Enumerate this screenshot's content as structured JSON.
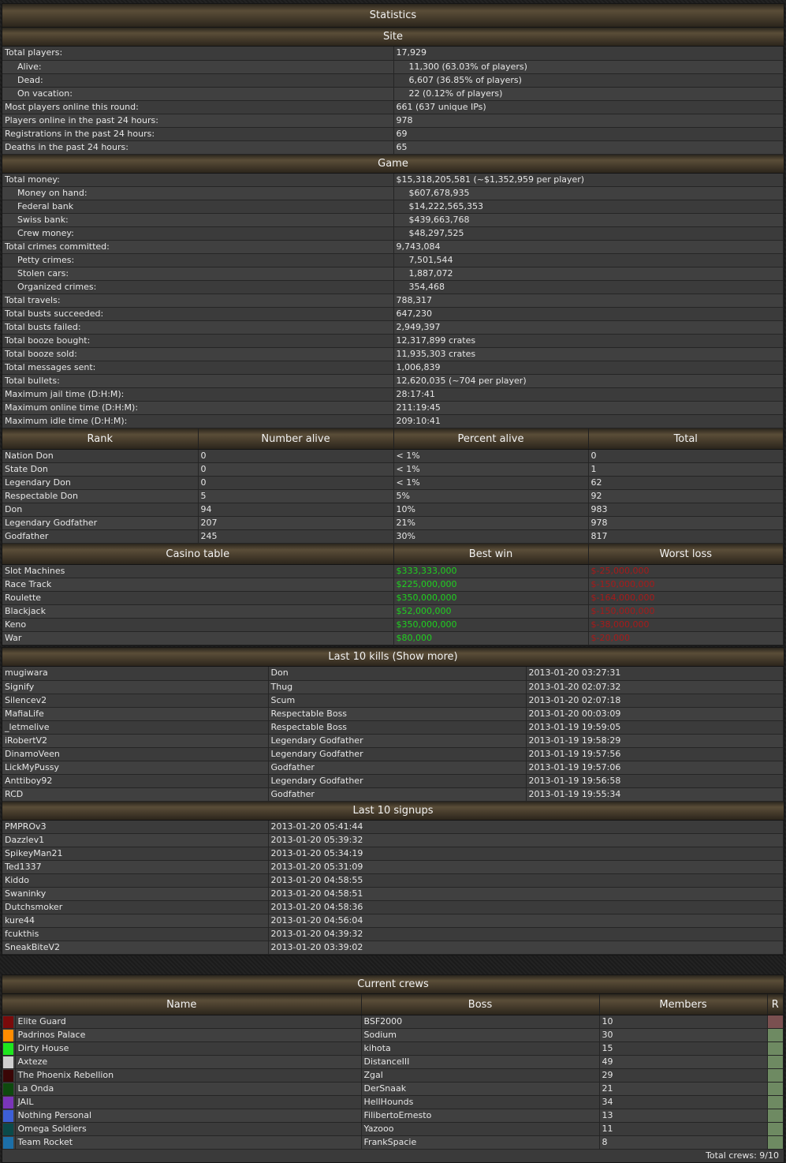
{
  "statistics": {
    "title": "Statistics",
    "site_header": "Site",
    "site_rows": [
      {
        "label": "Total players:",
        "value": "17,929",
        "indent": false
      },
      {
        "label": "Alive:",
        "value": "11,300 (63.03% of players)",
        "indent": true
      },
      {
        "label": "Dead:",
        "value": "6,607 (36.85% of players)",
        "indent": true
      },
      {
        "label": "On vacation:",
        "value": "22 (0.12% of players)",
        "indent": true
      },
      {
        "label": "Most players online this round:",
        "value": "661 (637 unique IPs)",
        "indent": false
      },
      {
        "label": "Players online in the past 24 hours:",
        "value": "978",
        "indent": false
      },
      {
        "label": "Registrations in the past 24 hours:",
        "value": "69",
        "indent": false
      },
      {
        "label": "Deaths in the past 24 hours:",
        "value": "65",
        "indent": false
      }
    ],
    "game_header": "Game",
    "game_rows": [
      {
        "label": "Total money:",
        "value": "$15,318,205,581 (~$1,352,959 per player)",
        "indent": false
      },
      {
        "label": "Money on hand:",
        "value": "$607,678,935",
        "indent": true
      },
      {
        "label": "Federal bank",
        "value": "$14,222,565,353",
        "indent": true
      },
      {
        "label": "Swiss bank:",
        "value": "$439,663,768",
        "indent": true
      },
      {
        "label": "Crew money:",
        "value": "$48,297,525",
        "indent": true
      },
      {
        "label": "Total crimes committed:",
        "value": "9,743,084",
        "indent": false
      },
      {
        "label": "Petty crimes:",
        "value": "7,501,544",
        "indent": true
      },
      {
        "label": "Stolen cars:",
        "value": "1,887,072",
        "indent": true
      },
      {
        "label": "Organized crimes:",
        "value": "354,468",
        "indent": true
      },
      {
        "label": "Total travels:",
        "value": "788,317",
        "indent": false
      },
      {
        "label": "Total busts succeeded:",
        "value": "647,230",
        "indent": false
      },
      {
        "label": "Total busts failed:",
        "value": "2,949,397",
        "indent": false
      },
      {
        "label": "Total booze bought:",
        "value": "12,317,899 crates",
        "indent": false
      },
      {
        "label": "Total booze sold:",
        "value": "11,935,303 crates",
        "indent": false
      },
      {
        "label": "Total messages sent:",
        "value": "1,006,839",
        "indent": false
      },
      {
        "label": "Total bullets:",
        "value": "12,620,035 (~704 per player)",
        "indent": false
      },
      {
        "label": "Maximum jail time (D:H:M):",
        "value": "28:17:41",
        "indent": false
      },
      {
        "label": "Maximum online time (D:H:M):",
        "value": "211:19:45",
        "indent": false
      },
      {
        "label": "Maximum idle time (D:H:M):",
        "value": "209:10:41",
        "indent": false
      }
    ],
    "rank_headers": [
      "Rank",
      "Number alive",
      "Percent alive",
      "Total"
    ],
    "rank_rows": [
      [
        "Nation Don",
        "0",
        "< 1%",
        "0"
      ],
      [
        "State Don",
        "0",
        "< 1%",
        "1"
      ],
      [
        "Legendary Don",
        "0",
        "< 1%",
        "62"
      ],
      [
        "Respectable Don",
        "5",
        "5%",
        "92"
      ],
      [
        "Don",
        "94",
        "10%",
        "983"
      ],
      [
        "Legendary Godfather",
        "207",
        "21%",
        "978"
      ],
      [
        "Godfather",
        "245",
        "30%",
        "817"
      ]
    ],
    "casino_headers": [
      "Casino table",
      "Best win",
      "Worst loss"
    ],
    "casino_rows": [
      [
        "Slot Machines",
        "$333,333,000",
        "$-25,000,000"
      ],
      [
        "Race Track",
        "$225,000,000",
        "$-150,000,000"
      ],
      [
        "Roulette",
        "$350,000,000",
        "$-164,000,000"
      ],
      [
        "Blackjack",
        "$52,000,000",
        "$-150,000,000"
      ],
      [
        "Keno",
        "$350,000,000",
        "$-38,000,000"
      ],
      [
        "War",
        "$80,000",
        "$-20,000"
      ]
    ]
  },
  "kills": {
    "title": "Last 10 kills (Show more)",
    "rows": [
      [
        "mugiwara",
        "Don",
        "2013-01-20 03:27:31"
      ],
      [
        "Signify",
        "Thug",
        "2013-01-20 02:07:32"
      ],
      [
        "Silencev2",
        "Scum",
        "2013-01-20 02:07:18"
      ],
      [
        "MafiaLife",
        "Respectable Boss",
        "2013-01-20 00:03:09"
      ],
      [
        "_letmelive",
        "Respectable Boss",
        "2013-01-19 19:59:05"
      ],
      [
        "iRobertV2",
        "Legendary Godfather",
        "2013-01-19 19:58:29"
      ],
      [
        "DinamoVeen",
        "Legendary Godfather",
        "2013-01-19 19:57:56"
      ],
      [
        "LickMyPussy",
        "Godfather",
        "2013-01-19 19:57:06"
      ],
      [
        "Anttiboy92",
        "Legendary Godfather",
        "2013-01-19 19:56:58"
      ],
      [
        "RCD",
        "Godfather",
        "2013-01-19 19:55:34"
      ]
    ]
  },
  "signups": {
    "title": "Last 10 signups",
    "rows": [
      [
        "PMPROv3",
        "2013-01-20 05:41:44"
      ],
      [
        "Dazzlev1",
        "2013-01-20 05:39:32"
      ],
      [
        "SpikeyMan21",
        "2013-01-20 05:34:19"
      ],
      [
        "Ted1337",
        "2013-01-20 05:31:09"
      ],
      [
        "Kiddo",
        "2013-01-20 04:58:55"
      ],
      [
        "Swaninky",
        "2013-01-20 04:58:51"
      ],
      [
        "Dutchsmoker",
        "2013-01-20 04:58:36"
      ],
      [
        "kure44",
        "2013-01-20 04:56:04"
      ],
      [
        "fcukthis",
        "2013-01-20 04:39:32"
      ],
      [
        "SneakBiteV2",
        "2013-01-20 03:39:02"
      ]
    ]
  },
  "crews": {
    "title": "Current crews",
    "headers": [
      "Name",
      "Boss",
      "Members",
      "R"
    ],
    "rows": [
      {
        "color": "#7a0b0b",
        "name": "Elite Guard",
        "boss": "BSF2000",
        "members": "10"
      },
      {
        "color": "#ff8c00",
        "name": "Padrinos Palace",
        "boss": "Sodium",
        "members": "30"
      },
      {
        "color": "#1ee61e",
        "name": "Dirty House",
        "boss": "kihota",
        "members": "15"
      },
      {
        "color": "#cfcfcf",
        "name": "Axteze",
        "boss": "DistanceIII",
        "members": "49"
      },
      {
        "color": "#3a0606",
        "name": "The Phoenix Rebellion",
        "boss": "Zgal",
        "members": "29"
      },
      {
        "color": "#0e4a0e",
        "name": "La Onda",
        "boss": "DerSnaak",
        "members": "21"
      },
      {
        "color": "#7a35b8",
        "name": "JAIL",
        "boss": "HellHounds",
        "members": "34"
      },
      {
        "color": "#3d5fd6",
        "name": "Nothing Personal",
        "boss": "FilibertoErnesto",
        "members": "13"
      },
      {
        "color": "#0b4a4a",
        "name": "Omega Soldiers",
        "boss": "Yazooo",
        "members": "11"
      },
      {
        "color": "#1c6fa8",
        "name": "Team Rocket",
        "boss": "FrankSpacie",
        "members": "8"
      }
    ],
    "footer": "Total crews: 9/10"
  }
}
